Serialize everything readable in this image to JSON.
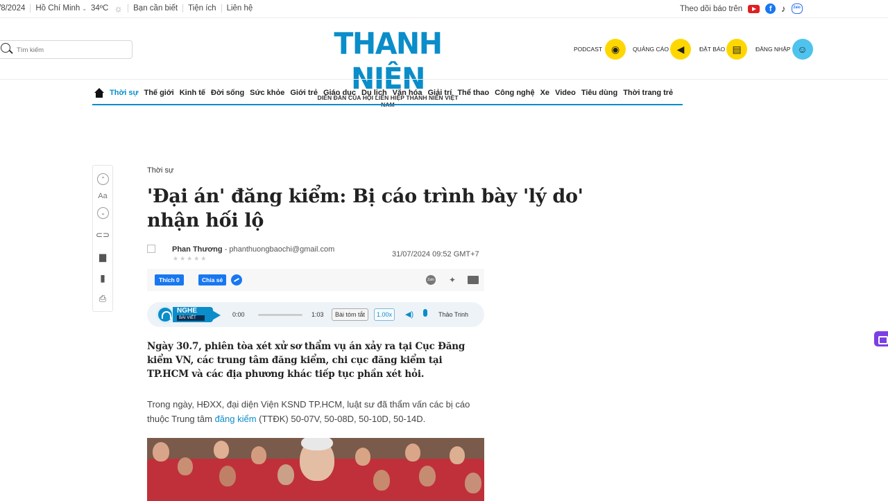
{
  "topbar": {
    "date": "/8/2024",
    "city": "Hồ Chí Minh",
    "temp": "34ºC",
    "links": [
      "Bạn cần biết",
      "Tiện ích",
      "Liên hệ"
    ],
    "follow_label": "Theo dõi báo trên"
  },
  "header": {
    "search_placeholder": "Tìm kiếm",
    "logo_main": "THANH NIÊN",
    "logo_tagline": "DIỄN ĐÀN CỦA HỘI LIÊN HIỆP THANH NIÊN VIỆT NAM",
    "podcast": "PODCAST",
    "ads": "QUẢNG CÁO",
    "subscribe": "ĐẶT BÁO",
    "login": "ĐĂNG NHẬP"
  },
  "nav": {
    "items": [
      "Thời sự",
      "Thế giới",
      "Kinh tế",
      "Đời sống",
      "Sức khỏe",
      "Giới trẻ",
      "Giáo dục",
      "Du lịch",
      "Văn hóa",
      "Giải trí",
      "Thể thao",
      "Công nghệ",
      "Xe",
      "Video",
      "Tiêu dùng",
      "Thời trang trẻ"
    ]
  },
  "tools": {
    "font_label": "Aa"
  },
  "article": {
    "category": "Thời sự",
    "title": "'Đại án' đăng kiểm: Bị cáo trình bày 'lý do' nhận hối lộ",
    "author": "Phan Thương",
    "author_email": "- phanthuongbaochi@gmail.com",
    "date": "31/07/2024 09:52 GMT+7",
    "lead": "Ngày 30.7, phiên tòa xét xử sơ thẩm vụ án xảy ra tại Cục Đăng kiểm VN, các trung tâm đăng kiểm, chi cục đăng kiểm tại TP.HCM và các địa phương khác tiếp tục phần xét hỏi.",
    "body_before_link": "Trong ngày, HĐXX, đại diện Viện KSND TP.HCM, luật sư đã thẩm vấn các bị cáo thuộc Trung tâm ",
    "body_link": "đăng kiểm",
    "body_after_link": " (TTĐK) 50-07V, 50-08D, 50-10D, 50-14D."
  },
  "share": {
    "like_label": "Thích 0",
    "share_label": "Chia sẻ",
    "zalo_label": "Zalo"
  },
  "audio": {
    "listen_label": "NGHE",
    "listen_sub": "BÀI VIẾT",
    "current_time": "0:00",
    "duration": "1:03",
    "summary_label": "Bài tóm tắt",
    "speed": "1.00x",
    "voice": "Thảo Trinh",
    "progress": 0
  },
  "colors": {
    "accent": "#0a8dc9",
    "header_circle": "#ffd700",
    "login_circle": "#4ec3ee"
  },
  "icons": {
    "weather": "sun-icon",
    "youtube": "youtube-icon",
    "facebook": "facebook-icon",
    "tiktok": "tiktok-icon",
    "zalo": "zalo-icon"
  }
}
